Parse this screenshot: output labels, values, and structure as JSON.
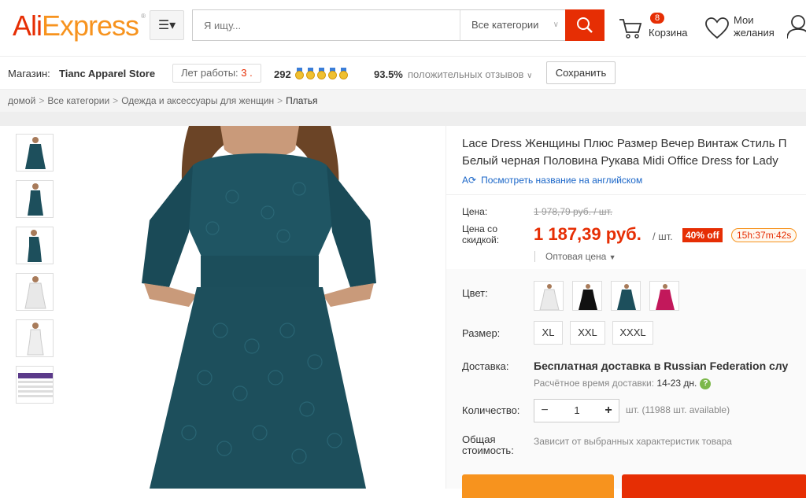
{
  "header": {
    "logo_part1": "Ali",
    "logo_part2": "Express",
    "logo_tm": "®",
    "menu_icon": "menu-icon",
    "search_placeholder": "Я ищу...",
    "category_label": "Все категории",
    "cart_count": "8",
    "cart_label": "Корзина",
    "wishlist_line1": "Мои",
    "wishlist_line2": "желания",
    "colors": {
      "brand_red": "#e62e04",
      "brand_orange": "#f7931e"
    }
  },
  "store": {
    "label": "Магазин:",
    "name": "Tianc Apparel Store",
    "years_label": "Лет работы:",
    "years_value": "3 .",
    "score": "292",
    "positive_pct": "93.5%",
    "positive_label": "положительных отзывов",
    "save_label": "Сохранить"
  },
  "breadcrumb": {
    "items": [
      "домой",
      "Все категории",
      "Одежда и аксессуары для женщин",
      "Платья"
    ],
    "separator": ">"
  },
  "product": {
    "title_line1": "Lace Dress Женщины Плюс Размер Вечер Винтаж Стиль П",
    "title_line2": "Белый черная Половина Рукава Midi Office Dress for Lady",
    "translate_label": "Посмотреть название на английском",
    "price_label": "Цена:",
    "old_price": "1 978,79 руб. / шт.",
    "discount_label_1": "Цена со",
    "discount_label_2": "скидкой:",
    "new_price": "1 187,39 руб.",
    "unit": "/ шт.",
    "off_badge": "40% off",
    "timer": "15h:37m:42s",
    "wholesale_label": "Оптовая цена",
    "color_label": "Цвет:",
    "size_label": "Размер:",
    "sizes": [
      "XL",
      "XXL",
      "XXXL"
    ],
    "delivery_label": "Доставка:",
    "delivery_text_bold": "Бесплатная доставка в",
    "delivery_country": " Russian Federation слу",
    "delivery_time_label": "Расчётное время доставки:",
    "delivery_time_value": "14-23 дн.",
    "qty_label": "Количество:",
    "qty_value": "1",
    "qty_minus": "−",
    "qty_plus": "+",
    "available": "шт. (11988 шт. available)",
    "total_label_1": "Общая",
    "total_label_2": "стоимость:",
    "total_value": "Зависит от выбранных характеристик товара"
  }
}
